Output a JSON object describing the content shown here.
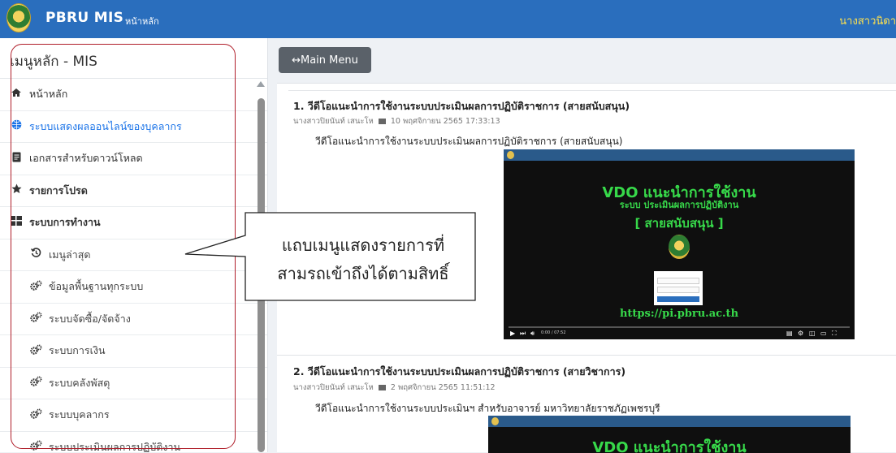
{
  "topbar": {
    "app_title": "PBRU MIS",
    "home_link": "หน้าหลัก",
    "username": "นางสาวนิดา"
  },
  "sidebar": {
    "title": "เมนูหลัก - MIS",
    "items": [
      {
        "label": "หน้าหลัก",
        "icon": "home-icon"
      },
      {
        "label": "ระบบแสดงผลออนไลน์ของบุคลากร",
        "icon": "globe-icon"
      },
      {
        "label": "เอกสารสำหรับดาวน์โหลด",
        "icon": "document-icon"
      },
      {
        "label": "รายการโปรด",
        "icon": "star-icon"
      },
      {
        "label": "ระบบการทำงาน",
        "icon": "grid-icon"
      },
      {
        "label": "เมนูล่าสุด",
        "icon": "history-icon"
      },
      {
        "label": "ข้อมูลพื้นฐานทุกระบบ",
        "icon": "cogs-icon"
      },
      {
        "label": "ระบบจัดซื้อ/จัดจ้าง",
        "icon": "cogs-icon"
      },
      {
        "label": "ระบบการเงิน",
        "icon": "cogs-icon"
      },
      {
        "label": "ระบบคลังพัสดุ",
        "icon": "cogs-icon"
      },
      {
        "label": "ระบบบุคลากร",
        "icon": "cogs-icon"
      },
      {
        "label": "ระบบประเมินผลการปฏิบัติงาน",
        "icon": "cogs-icon"
      }
    ]
  },
  "main_menu_button": "↔Main Menu",
  "posts": [
    {
      "title": "1. วีดีโอแนะนำการใช้งานระบบประเมินผลการปฏิบัติราชการ (สายสนับสนุน)",
      "author": "นางสาวปิยนันท์ เสนะโห",
      "date": "10 พฤศจิกายน 2565 17:33:13",
      "description": "วีดีโอแนะนำการใช้งานระบบประเมินผลการปฏิบัติราชการ (สายสนับสนุน)",
      "video": {
        "title": "VDO แนะนำการใช้งาน",
        "subtitle": "ระบบ ประเมินผลการปฏิบัติงาน",
        "tag": "[ สายสนับสนุน ]",
        "url": "https://pi.pbru.ac.th",
        "time": "0:00 / 07:52"
      }
    },
    {
      "title": "2. วีดีโอแนะนำการใช้งานระบบประเมินผลการปฏิบัติราชการ (สายวิชาการ)",
      "author": "นางสาวปิยนันท์ เสนะโห",
      "date": "2 พฤศจิกายน 2565 11:51:12",
      "description": "วีดีโอแนะนำการใช้งานระบบประเมินฯ สำหรับอาจารย์ มหาวิทยาลัยราชภัฏเพชรบุรี",
      "video": {
        "title": "VDO แนะนำการใช้งาน"
      }
    }
  ],
  "callout": {
    "line1": "แถบเมนูแสดงรายการที่",
    "line2": "สามรถเข้าถึงได้ตามสิทธิ์"
  },
  "colors": {
    "topbar": "#2a6ebd",
    "username": "#ffe14d",
    "active_link": "#1a73e8",
    "highlight_outline": "#b01e2a",
    "video_text": "#37d94a"
  }
}
